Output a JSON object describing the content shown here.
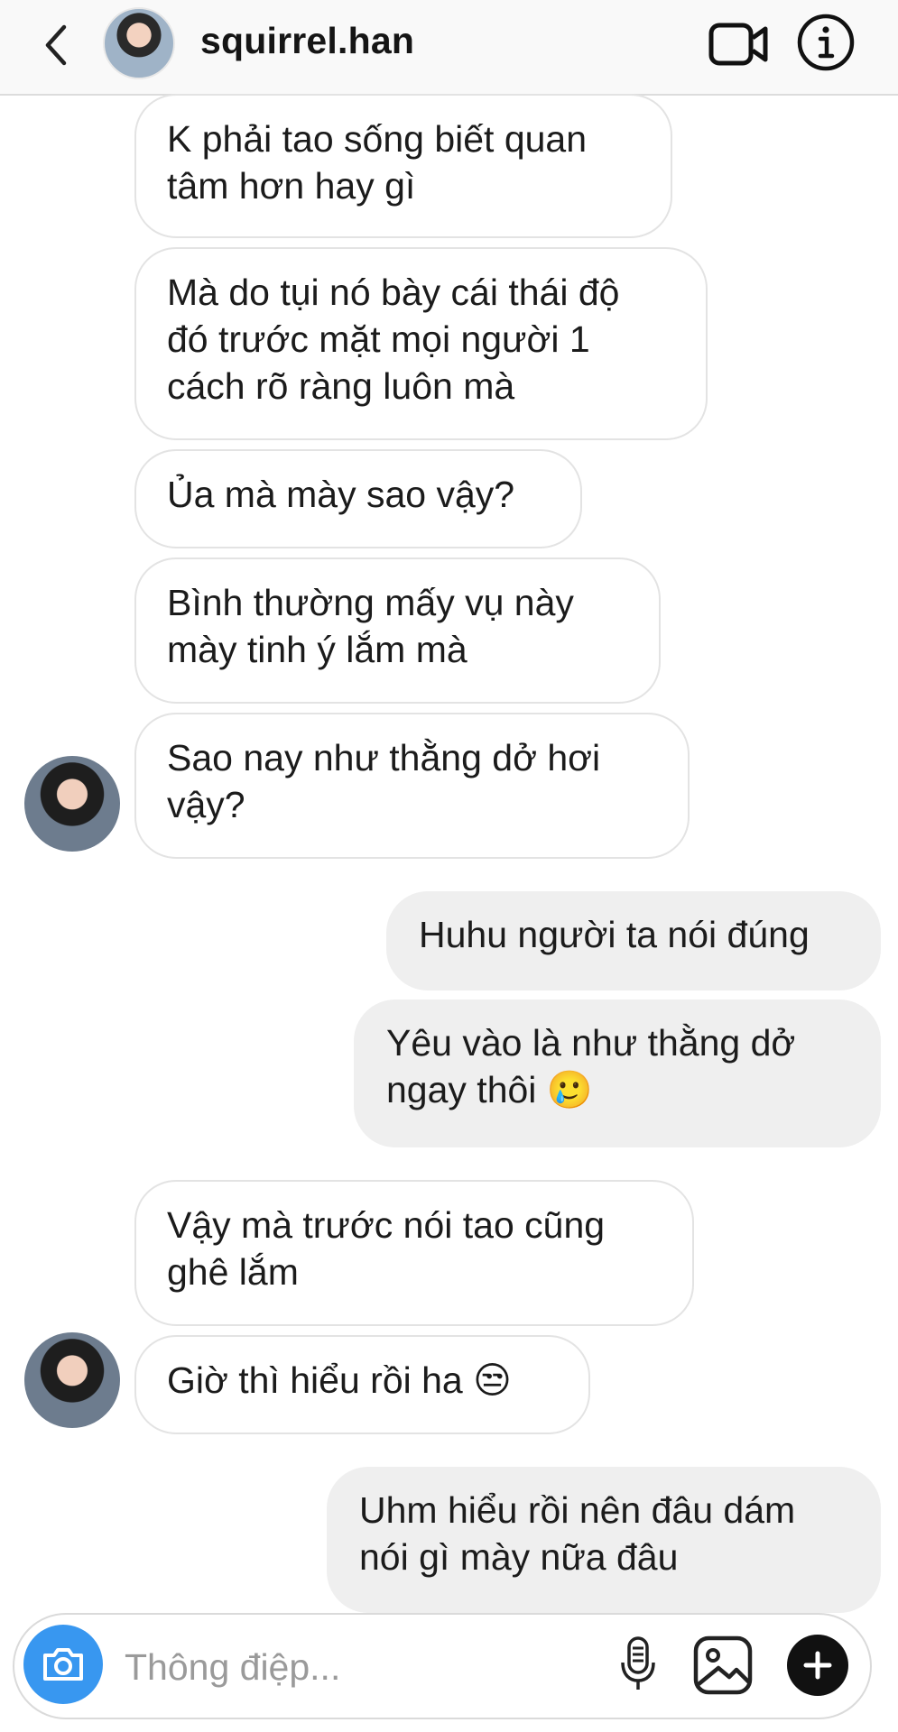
{
  "header": {
    "username": "squirrel.han",
    "back_icon": "chevron-left-icon",
    "video_icon": "video-call-icon",
    "info_icon": "info-icon"
  },
  "messages": [
    {
      "direction": "incoming",
      "text": "K phải tao sống biết quan\ntâm hơn hay gì"
    },
    {
      "direction": "incoming",
      "text": "Mà do tụi nó bày cái thái độ\nđó trước mặt mọi người 1\ncách rõ ràng luôn mà"
    },
    {
      "direction": "incoming",
      "text": "Ủa mà mày sao vậy?"
    },
    {
      "direction": "incoming",
      "text": "Bình thường mấy vụ này\nmày tinh ý lắm mà"
    },
    {
      "direction": "incoming",
      "text": "Sao nay như thằng dở hơi\nvậy?"
    },
    {
      "direction": "outgoing",
      "text": "Huhu người ta nói đúng"
    },
    {
      "direction": "outgoing",
      "text": "Yêu vào là như thằng dở\nngay thôi 🥲"
    },
    {
      "direction": "incoming",
      "text": "Vậy mà trước nói tao cũng\nghê lắm"
    },
    {
      "direction": "incoming",
      "text": "Giờ thì hiểu rồi ha 😒"
    },
    {
      "direction": "outgoing",
      "text": "Uhm hiểu rồi nên đâu dám\nnói gì mày nữa đâu"
    }
  ],
  "composer": {
    "placeholder": "Thông điệp...",
    "camera_icon": "camera-icon",
    "mic_icon": "microphone-icon",
    "gallery_icon": "gallery-icon",
    "plus_icon": "plus-icon"
  },
  "colors": {
    "accent": "#3897f0",
    "outgoing_bubble": "#efefef",
    "incoming_border": "#e3e3e3"
  }
}
